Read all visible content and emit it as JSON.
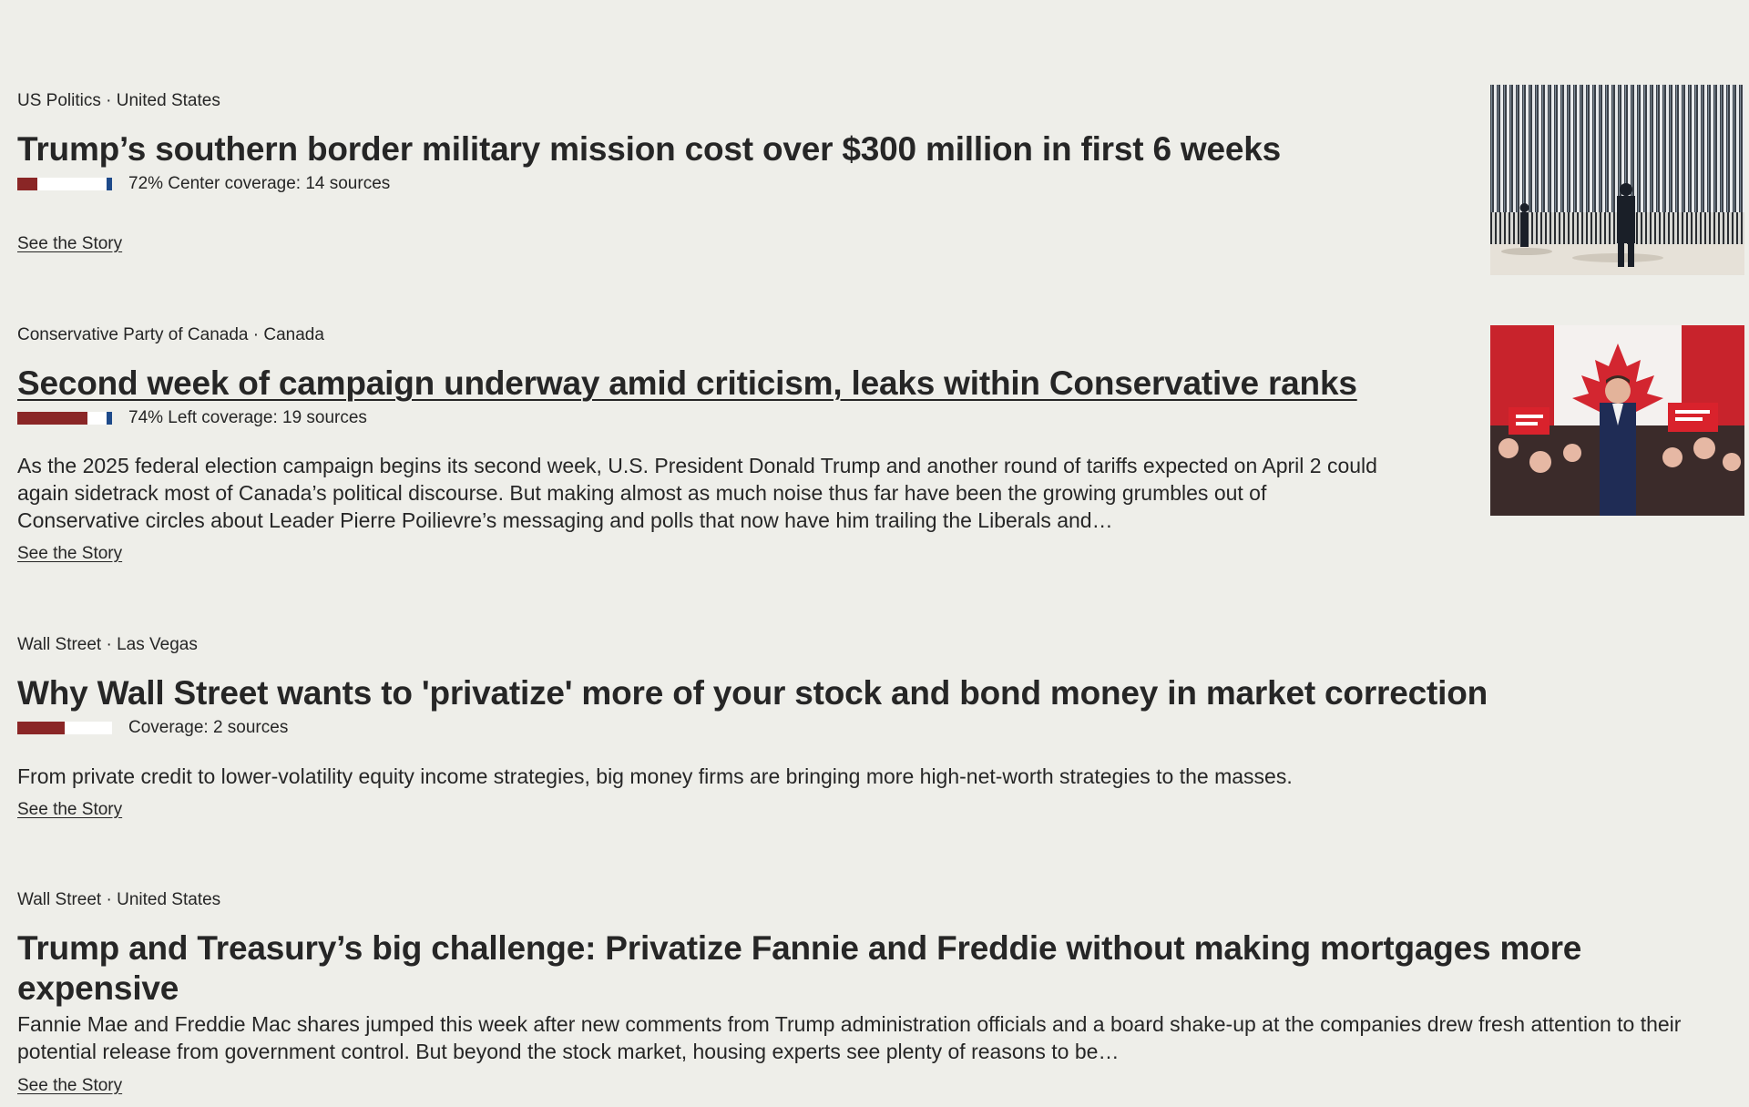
{
  "stories": [
    {
      "category": "US Politics",
      "separator": "·",
      "location": "United States",
      "headline": "Trump’s southern border military mission cost over $300 million in first 6 weeks",
      "coverage_text": "72% Center coverage: 14 sources",
      "bias": {
        "left": 0.22,
        "center": 0.72,
        "right": 0.06
      },
      "summary": "",
      "link_label": "See the Story",
      "image": "border-wall-photo"
    },
    {
      "category": "Conservative Party of Canada",
      "separator": "·",
      "location": "Canada",
      "headline": "Second week of campaign underway amid criticism, leaks within Conservative ranks",
      "coverage_text": "74% Left coverage: 19 sources",
      "bias": {
        "left": 0.74,
        "center": 0.2,
        "right": 0.06
      },
      "summary": "As the 2025 federal election campaign begins its second week, U.S. President Donald Trump and another round of tariffs expected on April 2 could again sidetrack most of Canada’s political discourse. But making almost as much noise thus far have been the growing grumbles out of Conservative circles about Leader Pierre Poilievre’s messaging and polls that now have him trailing the Liberals and…",
      "link_label": "See the Story",
      "image": "campaign-rally-photo"
    },
    {
      "category": "Wall Street",
      "separator": "·",
      "location": "Las Vegas",
      "headline": "Why Wall Street wants to 'privatize' more of your stock and bond money in market correction",
      "coverage_text": "Coverage: 2 sources",
      "bias": {
        "left": 0.5,
        "center": 0.5,
        "right": 0.0
      },
      "summary": "From private credit to lower-volatility equity income strategies, big money firms are bringing more high-net-worth strategies to the masses.",
      "link_label": "See the Story",
      "image": ""
    },
    {
      "category": "Wall Street",
      "separator": "·",
      "location": "United States",
      "headline": "Trump and Treasury’s big challenge: Privatize Fannie and Freddie without making mortgages more expensive",
      "coverage_text": "",
      "summary": "Fannie Mae and Freddie Mac shares jumped this week after new comments from Trump administration officials and a board shake-up at the companies drew fresh attention to their potential release from government control. But beyond the stock market, housing experts see plenty of reasons to be…",
      "link_label": "See the Story",
      "image": ""
    }
  ],
  "colors": {
    "background": "#eeeee9",
    "text": "#262626",
    "bias_left": "#8a2626",
    "bias_center": "#ffffff",
    "bias_right": "#1e4a8a"
  }
}
